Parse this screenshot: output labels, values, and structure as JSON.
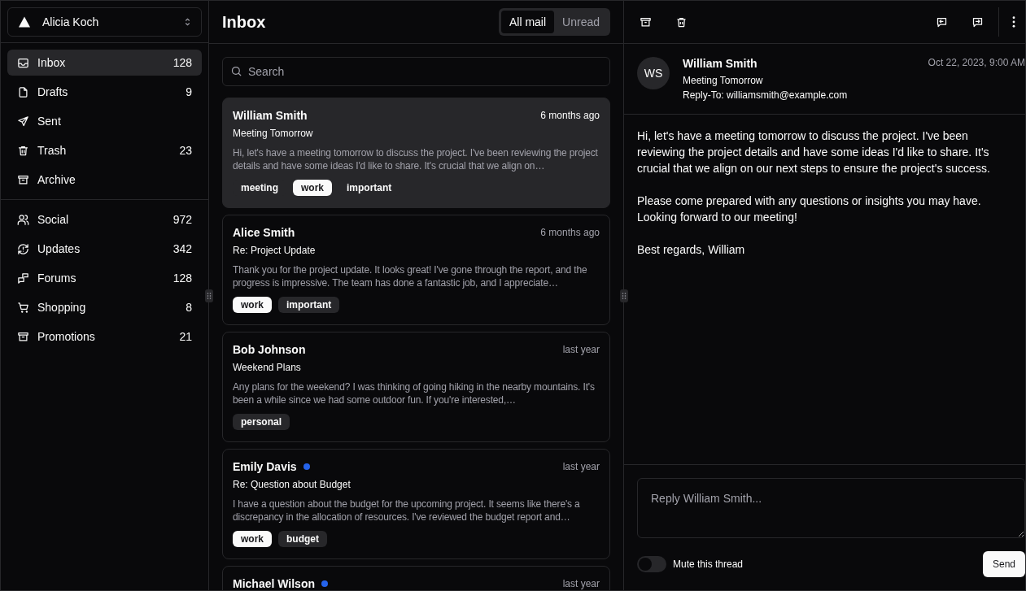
{
  "account": {
    "name": "Alicia Koch"
  },
  "nav_primary": [
    {
      "label": "Inbox",
      "count": "128",
      "selected": true
    },
    {
      "label": "Drafts",
      "count": "9",
      "selected": false
    },
    {
      "label": "Sent",
      "selected": false
    },
    {
      "label": "Trash",
      "count": "23",
      "selected": false
    },
    {
      "label": "Archive",
      "selected": false
    }
  ],
  "nav_secondary": [
    {
      "label": "Social",
      "count": "972",
      "selected": false
    },
    {
      "label": "Updates",
      "count": "342",
      "selected": false
    },
    {
      "label": "Forums",
      "count": "128",
      "selected": false
    },
    {
      "label": "Shopping",
      "count": "8",
      "selected": false
    },
    {
      "label": "Promotions",
      "count": "21",
      "selected": false
    }
  ],
  "list": {
    "title": "Inbox",
    "tabs": [
      {
        "label": "All mail",
        "selected": true
      },
      {
        "label": "Unread",
        "selected": false
      }
    ],
    "search": {
      "placeholder": "Search"
    },
    "mails": [
      {
        "name": "William Smith",
        "unread": false,
        "selected": true,
        "date": "6 months ago",
        "subject": "Meeting Tomorrow",
        "preview": "Hi, let's have a meeting tomorrow to discuss the project. I've been reviewing the project details and have some ideas I'd like to share. It's crucial that we align on…",
        "tags": [
          {
            "label": "meeting",
            "kind": "secondary"
          },
          {
            "label": "work",
            "kind": "primary"
          },
          {
            "label": "important",
            "kind": "secondary"
          }
        ]
      },
      {
        "name": "Alice Smith",
        "unread": false,
        "selected": false,
        "date": "6 months ago",
        "subject": "Re: Project Update",
        "preview": "Thank you for the project update. It looks great! I've gone through the report, and the progress is impressive. The team has done a fantastic job, and I appreciate…",
        "tags": [
          {
            "label": "work",
            "kind": "primary"
          },
          {
            "label": "important",
            "kind": "secondary"
          }
        ]
      },
      {
        "name": "Bob Johnson",
        "unread": false,
        "selected": false,
        "date": "last year",
        "subject": "Weekend Plans",
        "preview": "Any plans for the weekend? I was thinking of going hiking in the nearby mountains. It's been a while since we had some outdoor fun. If you're interested,…",
        "tags": [
          {
            "label": "personal",
            "kind": "secondary"
          }
        ]
      },
      {
        "name": "Emily Davis",
        "unread": true,
        "selected": false,
        "date": "last year",
        "subject": "Re: Question about Budget",
        "preview": "I have a question about the budget for the upcoming project. It seems like there's a discrepancy in the allocation of resources. I've reviewed the budget report and…",
        "tags": [
          {
            "label": "work",
            "kind": "primary"
          },
          {
            "label": "budget",
            "kind": "secondary"
          }
        ]
      },
      {
        "name": "Michael Wilson",
        "unread": true,
        "selected": false,
        "date": "last year"
      }
    ]
  },
  "detail": {
    "initials": "WS",
    "from": "William Smith",
    "subject": "Meeting Tomorrow",
    "reply_to_label": "Reply-To:",
    "reply_to": "williamsmith@example.com",
    "date": "Oct 22, 2023, 9:00 AM",
    "body": [
      "Hi, let's have a meeting tomorrow to discuss the project. I've been reviewing the project details and have some ideas I'd like to share. It's crucial that we align on our next steps to ensure the project's success.",
      "Please come prepared with any questions or insights you may have. Looking forward to our meeting!",
      "Best regards, William"
    ],
    "reply": {
      "placeholder": "Reply William Smith..."
    },
    "mute": {
      "label": "Mute this thread",
      "on": false
    },
    "send": "Send"
  }
}
